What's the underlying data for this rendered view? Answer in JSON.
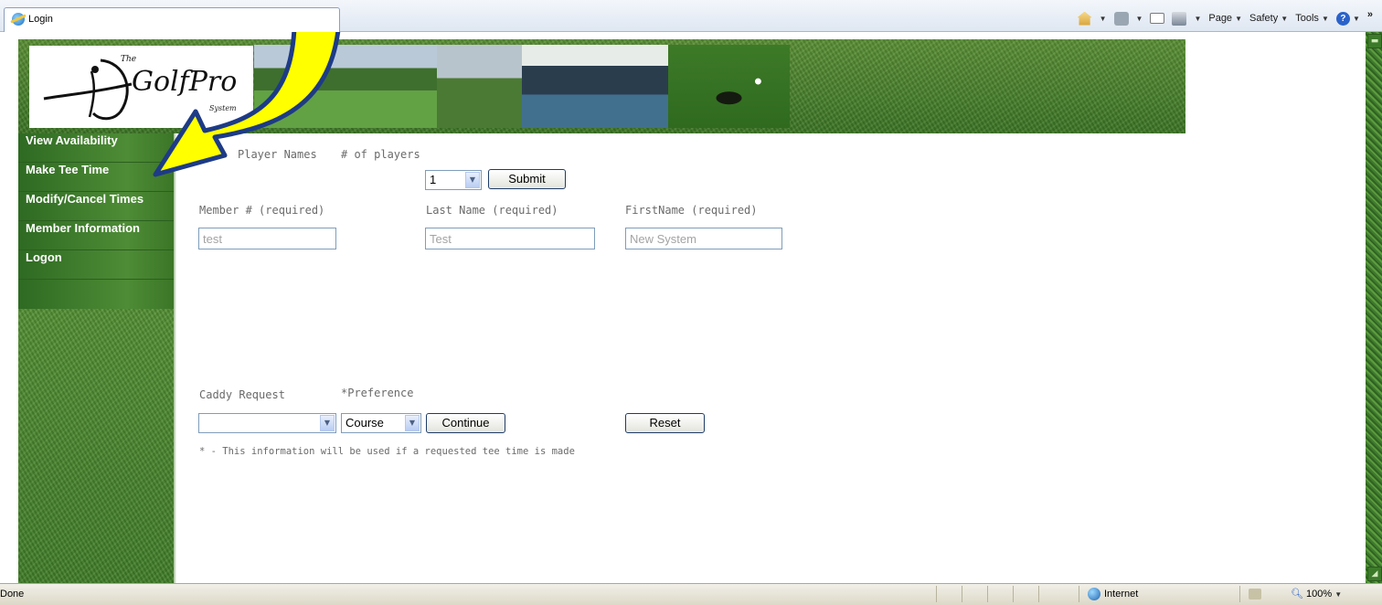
{
  "browser": {
    "tab_title": "Login",
    "commands": {
      "page": "Page",
      "safety": "Safety",
      "tools": "Tools",
      "help": "?",
      "overflow": "»"
    }
  },
  "brand": {
    "the": "The",
    "name": "GolfPro",
    "system": "System"
  },
  "nav": {
    "items": [
      {
        "label": "View Availability"
      },
      {
        "label": "Make Tee Time"
      },
      {
        "label": "Modify/Cancel Times"
      },
      {
        "label": "Member Information"
      },
      {
        "label": "Logon"
      }
    ]
  },
  "form": {
    "player_names_label": "Player Names",
    "num_players_label": "# of players",
    "num_players_value": "1",
    "submit_label": "Submit",
    "member_label": "Member # (required)",
    "last_name_label": "Last Name (required)",
    "first_name_label": "FirstName (required)",
    "member_value": "test",
    "last_name_value": "Test",
    "first_name_value": "New System",
    "caddy_label": "Caddy Request",
    "preference_label": "*Preference",
    "caddy_value": "",
    "preference_value": "Course",
    "continue_label": "Continue",
    "reset_label": "Reset",
    "footnote": "* - This information will be used if a requested tee time is made"
  },
  "status": {
    "text": "Done",
    "zone": "Internet",
    "zoom": "100%"
  },
  "colors": {
    "annotation_arrow": "#ffff00",
    "nav_green": "#3f7c27",
    "input_border": "#7f9db9"
  }
}
